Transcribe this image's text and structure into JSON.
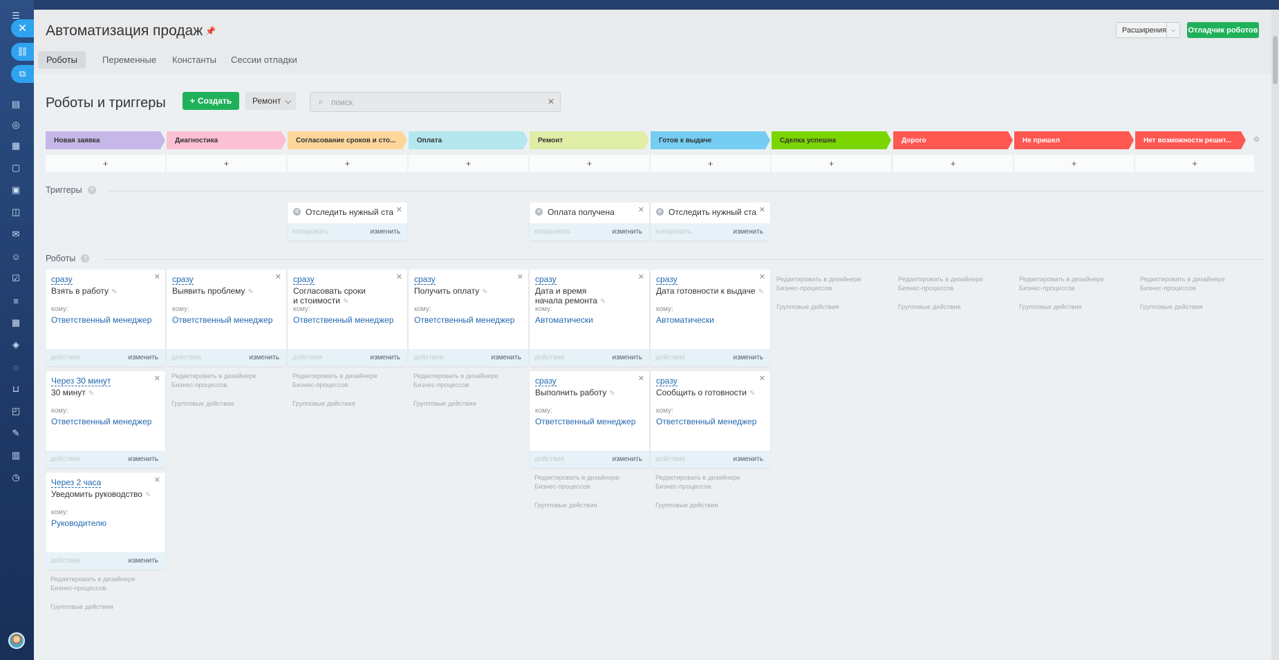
{
  "window": {
    "title": "Автоматизация продаж"
  },
  "header": {
    "extensions_label": "Расширения",
    "debugger_label": "Отладчик роботов",
    "tabs": [
      {
        "label": "Роботы",
        "active": true
      },
      {
        "label": "Переменные",
        "active": false
      },
      {
        "label": "Константы",
        "active": false
      },
      {
        "label": "Сессии отладки",
        "active": false
      }
    ]
  },
  "toolbar": {
    "section_title": "Роботы и триггеры",
    "create_label": "Создать",
    "pipeline_label": "Ремонт",
    "search_placeholder": "поиск"
  },
  "stages": [
    {
      "label": "Новая заявка",
      "color": "#c5b7e8",
      "text_color": "#333333"
    },
    {
      "label": "Диагностика",
      "color": "#fbc0d3",
      "text_color": "#333333"
    },
    {
      "label": "Согласование сроков и сто...",
      "color": "#fdd79a",
      "text_color": "#333333"
    },
    {
      "label": "Оплата",
      "color": "#b4e7ee",
      "text_color": "#333333"
    },
    {
      "label": "Ремонт",
      "color": "#e0eda6",
      "text_color": "#333333"
    },
    {
      "label": "Готов к выдаче",
      "color": "#76cdf3",
      "text_color": "#333333"
    },
    {
      "label": "Сделка успешна",
      "color": "#7bd500",
      "text_color": "#333333"
    },
    {
      "label": "Дорого",
      "color": "#ff5752",
      "text_color": "#ffffff"
    },
    {
      "label": "Не пришел",
      "color": "#ff5752",
      "text_color": "#ffffff"
    },
    {
      "label": "Нет возможности решит...",
      "color": "#ff5752",
      "text_color": "#ffffff"
    }
  ],
  "labels": {
    "triggers_title": "Триггеры",
    "robots_title": "Роботы",
    "copy": "копировать",
    "edit": "изменить",
    "actions": "действия",
    "to": "кому:",
    "designer_link": "Редактировать в дизайнере Бизнес-процессов",
    "group_actions": "Групповые действия",
    "add": "+"
  },
  "triggers": [
    {
      "stage": 2,
      "title": "Отследить нужный ста..."
    },
    {
      "stage": 4,
      "title": "Оплата получена"
    },
    {
      "stage": 5,
      "title": "Отследить нужный ста..."
    }
  ],
  "robots": [
    {
      "stage": 0,
      "row": 0,
      "when": "сразу",
      "title": "Взять в работу",
      "responsible": "Ответственный менеджер"
    },
    {
      "stage": 1,
      "row": 0,
      "when": "сразу",
      "title": "Выявить проблему",
      "responsible": "Ответственный менеджер"
    },
    {
      "stage": 2,
      "row": 0,
      "when": "сразу",
      "title": "Согласовать сроки и стоимости",
      "responsible": "Ответственный менеджер"
    },
    {
      "stage": 3,
      "row": 0,
      "when": "сразу",
      "title": "Получить оплату",
      "responsible": "Ответственный менеджер"
    },
    {
      "stage": 4,
      "row": 0,
      "when": "сразу",
      "title": "Дата и время начала ремонта",
      "responsible": "Автоматически"
    },
    {
      "stage": 5,
      "row": 0,
      "when": "сразу",
      "title": "Дата готовности к выдаче",
      "responsible": "Автоматически"
    },
    {
      "stage": 0,
      "row": 1,
      "when": "Через 30 минут",
      "title": "30 минут",
      "responsible": "Ответственный менеджер"
    },
    {
      "stage": 4,
      "row": 1,
      "when": "сразу",
      "title": "Выполнить работу",
      "responsible": "Ответственный менеджер"
    },
    {
      "stage": 5,
      "row": 1,
      "when": "сразу",
      "title": "Сообщить о готовности",
      "responsible": "Ответственный менеджер"
    },
    {
      "stage": 0,
      "row": 2,
      "when": "Через 2 часа",
      "title": "Уведомить руководство",
      "responsible": "Руководителю"
    }
  ]
}
